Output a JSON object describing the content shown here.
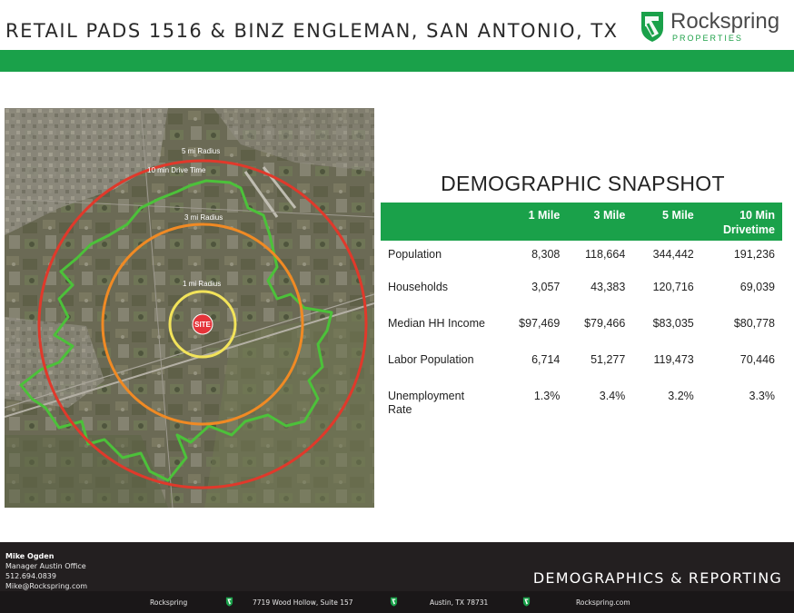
{
  "header": {
    "title": "RETAIL PADS 1516 & BINZ ENGLEMAN, SAN ANTONIO, TX",
    "logo_name": "Rockspring",
    "logo_sub": "PROPERTIES",
    "brand_color": "#1aa14a"
  },
  "map": {
    "labels": {
      "five_mile": "5 mi Radius",
      "drive": "10 min Drive Time",
      "three_mile": "3 mi Radius",
      "one_mile": "1 mi Radius",
      "site": "SITE"
    },
    "ring_colors": {
      "five_mile": "#e0392b",
      "three_mile": "#f08a24",
      "one_mile": "#f2e35a",
      "drive_time": "#4cc13a",
      "site": "#e5343a"
    }
  },
  "snapshot": {
    "title": "DEMOGRAPHIC SNAPSHOT",
    "columns": [
      "",
      "1 Mile",
      "3 Mile",
      "5 Mile",
      "10 Min Drivetime"
    ],
    "rows": [
      {
        "label": "Population",
        "values": [
          "8,308",
          "118,664",
          "344,442",
          "191,236"
        ]
      },
      {
        "label": "Households",
        "values": [
          "3,057",
          "43,383",
          "120,716",
          "69,039"
        ]
      },
      {
        "label": "Median HH Income",
        "values": [
          "$97,469",
          "$79,466",
          "$83,035",
          "$80,778"
        ]
      },
      {
        "label": "Labor Population",
        "values": [
          "6,714",
          "51,277",
          "119,473",
          "70,446"
        ]
      },
      {
        "label": "Unemployment Rate",
        "values": [
          "1.3%",
          "3.4%",
          "3.2%",
          "3.3%"
        ]
      }
    ]
  },
  "footer": {
    "contact_name": "Mike Ogden",
    "contact_title": "Manager Austin Office",
    "contact_phone": "512.694.0839",
    "contact_email": "Mike@Rockspring.com",
    "section_title": "DEMOGRAPHICS & REPORTING",
    "bar": {
      "company": "Rockspring",
      "address": "7719 Wood Hollow, Suite 157",
      "city": "Austin, TX 78731",
      "website": "Rockspring.com"
    }
  }
}
